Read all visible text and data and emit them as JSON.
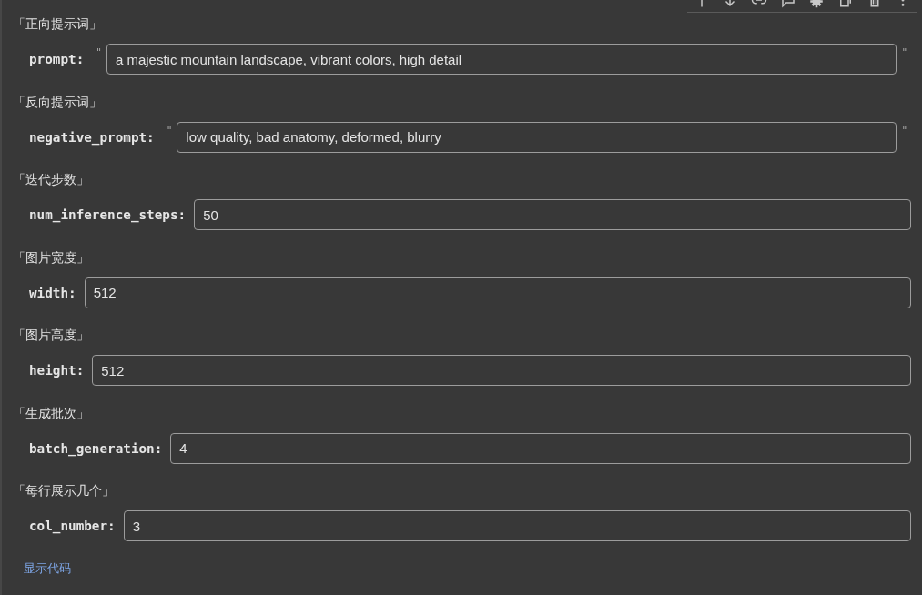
{
  "form": {
    "params": [
      {
        "heading": "「正向提示词」",
        "name": "prompt:",
        "kind": "string",
        "quote_open": "\"",
        "value": "a majestic mountain landscape, vibrant colors, high detail",
        "quote_close": "\""
      },
      {
        "heading": "「反向提示词」",
        "name": "negative_prompt:",
        "kind": "string",
        "quote_open": "\"",
        "value": "low quality, bad anatomy, deformed, blurry",
        "quote_close": "\""
      },
      {
        "heading": "「迭代步数」",
        "name": "num_inference_steps:",
        "kind": "integer",
        "value": "50"
      },
      {
        "heading": "「图片宽度」",
        "name": "width:",
        "kind": "integer",
        "value": "512"
      },
      {
        "heading": "「图片高度」",
        "name": "height:",
        "kind": "integer",
        "value": "512"
      },
      {
        "heading": "「生成批次」",
        "name": "batch_generation:",
        "kind": "integer",
        "value": "4"
      },
      {
        "heading": "「每行展示几个」",
        "name": "col_number:",
        "kind": "integer",
        "value": "3"
      }
    ],
    "show_code_link": "显示代码"
  }
}
